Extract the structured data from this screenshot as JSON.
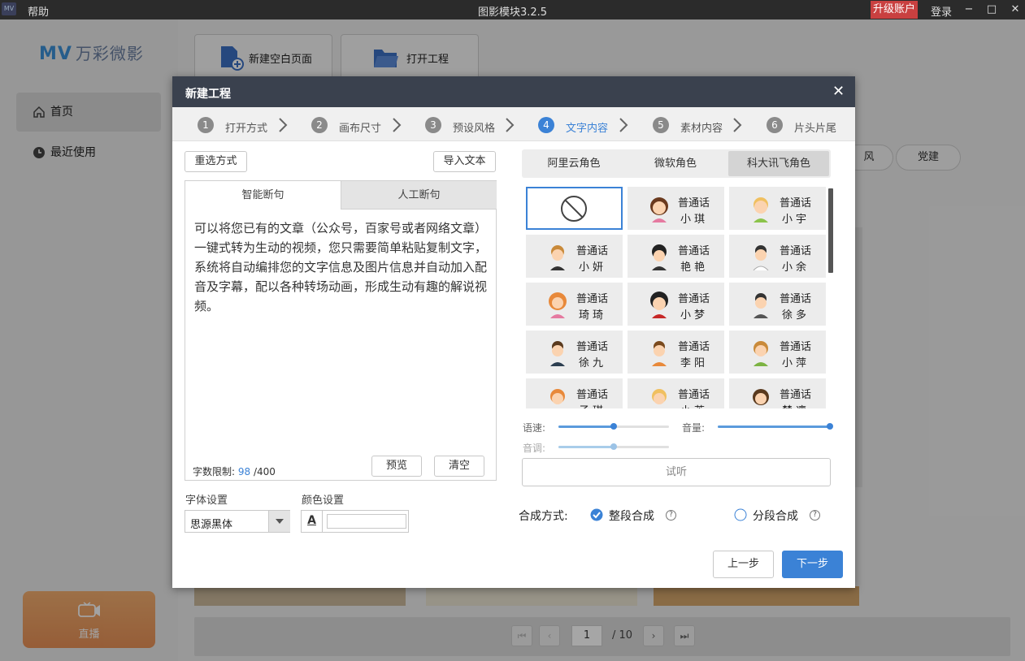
{
  "titlebar": {
    "logo": "MV",
    "help": "帮助",
    "title": "图影模块3.2.5",
    "upgrade": "升级账户",
    "login": "登录",
    "min": "−",
    "max": "□",
    "close": "✕"
  },
  "sidebar": {
    "brand_mv": "MV",
    "brand_cn": "万彩微影",
    "items": [
      {
        "label": "首页"
      },
      {
        "label": "最近使用"
      }
    ],
    "live_label": "直播"
  },
  "main": {
    "tiles": [
      {
        "label": "新建空白页面"
      },
      {
        "label": "打开工程"
      }
    ],
    "pills": [
      {
        "label": "风"
      },
      {
        "label": "党建"
      }
    ],
    "pager": {
      "first": "⏮",
      "prev": "‹",
      "page": "1",
      "total": "/ 10",
      "next": "›",
      "last": "⏭"
    }
  },
  "dialog": {
    "title": "新建工程",
    "close": "✕",
    "steps": [
      {
        "num": "1",
        "label": "打开方式"
      },
      {
        "num": "2",
        "label": "画布尺寸"
      },
      {
        "num": "3",
        "label": "预设风格"
      },
      {
        "num": "4",
        "label": "文字内容"
      },
      {
        "num": "5",
        "label": "素材内容"
      },
      {
        "num": "6",
        "label": "片头片尾"
      }
    ],
    "reselect": "重选方式",
    "import_text": "导入文本",
    "tabs": {
      "smart": "智能断句",
      "manual": "人工断句"
    },
    "body_text": "可以将您已有的文章（公众号，百家号或者网络文章）一键式转为生动的视频，您只需要简单粘贴复制文字，系统将自动编排您的文字信息及图片信息并自动加入配音及字幕，配以各种转场动画，形成生动有趣的解说视频。",
    "counter_label": "字数限制:",
    "counter_value": "98",
    "counter_max": "/400",
    "preview": "预览",
    "clear": "清空",
    "font_label": "字体设置",
    "font_value": "思源黑体",
    "color_label": "颜色设置",
    "color_a": "A",
    "role_tabs": [
      "阿里云角色",
      "微软角色",
      "科大讯飞角色"
    ],
    "voices": [
      {
        "l1": "",
        "l2": ""
      },
      {
        "l1": "普通话",
        "l2": "小琪"
      },
      {
        "l1": "普通话",
        "l2": "小宇"
      },
      {
        "l1": "普通话",
        "l2": "小妍"
      },
      {
        "l1": "普通话",
        "l2": "艳艳"
      },
      {
        "l1": "普通话",
        "l2": "小余"
      },
      {
        "l1": "普通话",
        "l2": "琦琦"
      },
      {
        "l1": "普通话",
        "l2": "小梦"
      },
      {
        "l1": "普通话",
        "l2": "徐多"
      },
      {
        "l1": "普通话",
        "l2": "徐九"
      },
      {
        "l1": "普通话",
        "l2": "李阳"
      },
      {
        "l1": "普通话",
        "l2": "小萍"
      },
      {
        "l1": "普通话",
        "l2": "子琪"
      },
      {
        "l1": "普通话",
        "l2": "小芳"
      },
      {
        "l1": "普通话",
        "l2": "楚凛"
      }
    ],
    "speed_label": "语速:",
    "volume_label": "音量:",
    "pitch_label": "音调:",
    "speed_value": 0.5,
    "volume_value": 1.0,
    "pitch_value": 0.5,
    "listen": "试听",
    "compose_label": "合成方式:",
    "compose_whole": "整段合成",
    "compose_split": "分段合成",
    "help": "?",
    "prev": "上一步",
    "next": "下一步"
  },
  "colors": {
    "accent": "#3b82d6",
    "header": "#3a414e",
    "upgrade": "#c94040"
  }
}
